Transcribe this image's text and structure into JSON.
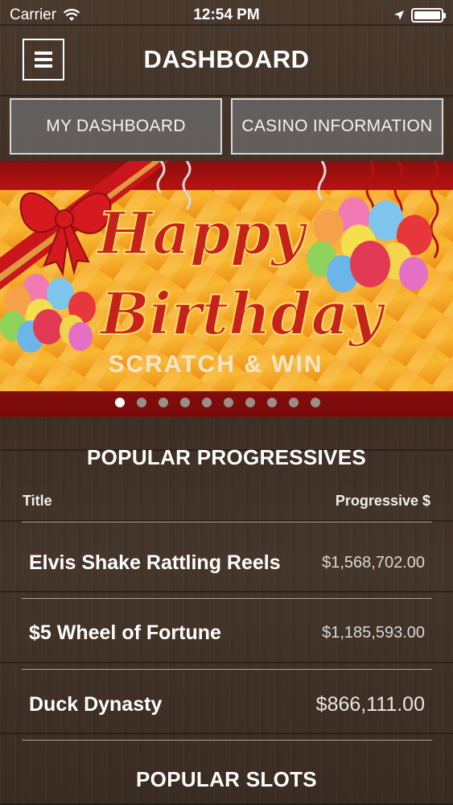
{
  "status_bar": {
    "carrier": "Carrier",
    "time": "12:54 PM",
    "wifi_icon": "wifi-icon",
    "location_icon": "location-arrow-icon",
    "battery_icon": "battery-icon"
  },
  "nav": {
    "menu_icon": "hamburger-menu-icon",
    "title": "DASHBOARD"
  },
  "tabs": [
    {
      "label": "MY DASHBOARD"
    },
    {
      "label": "CASINO INFORMATION"
    }
  ],
  "banner": {
    "line1": "Happy",
    "line2": "Birthday",
    "line3": "SCRATCH & WIN",
    "page_count": 10,
    "active_page": 1
  },
  "progressives": {
    "title": "POPULAR PROGRESSIVES",
    "col_title": "Title",
    "col_value": "Progressive $",
    "rows": [
      {
        "title": "Elvis Shake Rattling Reels",
        "value": "$1,568,702.00"
      },
      {
        "title": "$5 Wheel of Fortune",
        "value": "$1,185,593.00"
      },
      {
        "title": "Duck Dynasty",
        "value": "$866,111.00"
      }
    ]
  },
  "slots": {
    "title": "POPULAR SLOTS"
  },
  "colors": {
    "wood": "#3d2e24",
    "banner_red": "#b3130f",
    "banner_orange": "#f7a21b",
    "tab_bg": "#6e6e6e"
  }
}
